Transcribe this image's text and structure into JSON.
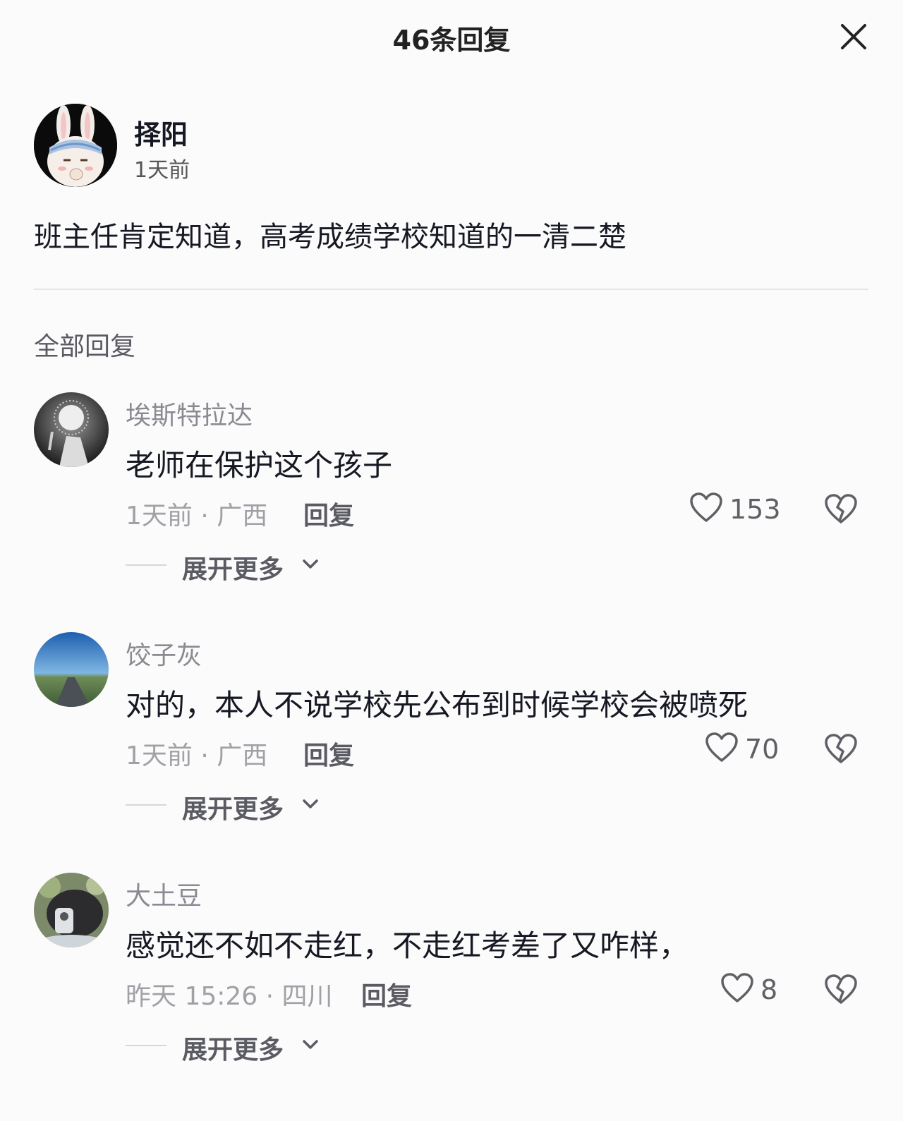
{
  "header": {
    "title": "46条回复",
    "close_icon": "close-icon"
  },
  "post": {
    "author": "择阳",
    "time": "1天前",
    "text": "班主任肯定知道，高考成绩学校知道的一清二楚"
  },
  "section_label": "全部回复",
  "replies": [
    {
      "name": "埃斯特拉达",
      "text": "老师在保护这个孩子",
      "meta": "1天前 · 广西",
      "reply_label": "回复",
      "likes": "153",
      "expand_label": "展开更多"
    },
    {
      "name": "饺子灰",
      "text": "对的，本人不说学校先公布到时候学校会被喷死",
      "meta": "1天前 · 广西",
      "reply_label": "回复",
      "likes": "70",
      "expand_label": "展开更多"
    },
    {
      "name": "大土豆",
      "text": "感觉还不如不走红，不走红考差了又咋样，",
      "meta": "昨天 15:26 · 四川",
      "reply_label": "回复",
      "likes": "8",
      "expand_label": "展开更多"
    }
  ],
  "icons": {
    "like": "heart-outline-icon",
    "dislike": "broken-heart-icon",
    "expand": "chevron-down-icon"
  },
  "colors": {
    "background": "#fbfbfb",
    "text_primary": "#161823",
    "text_secondary": "#8a8a92",
    "divider": "#e6e6e8"
  }
}
